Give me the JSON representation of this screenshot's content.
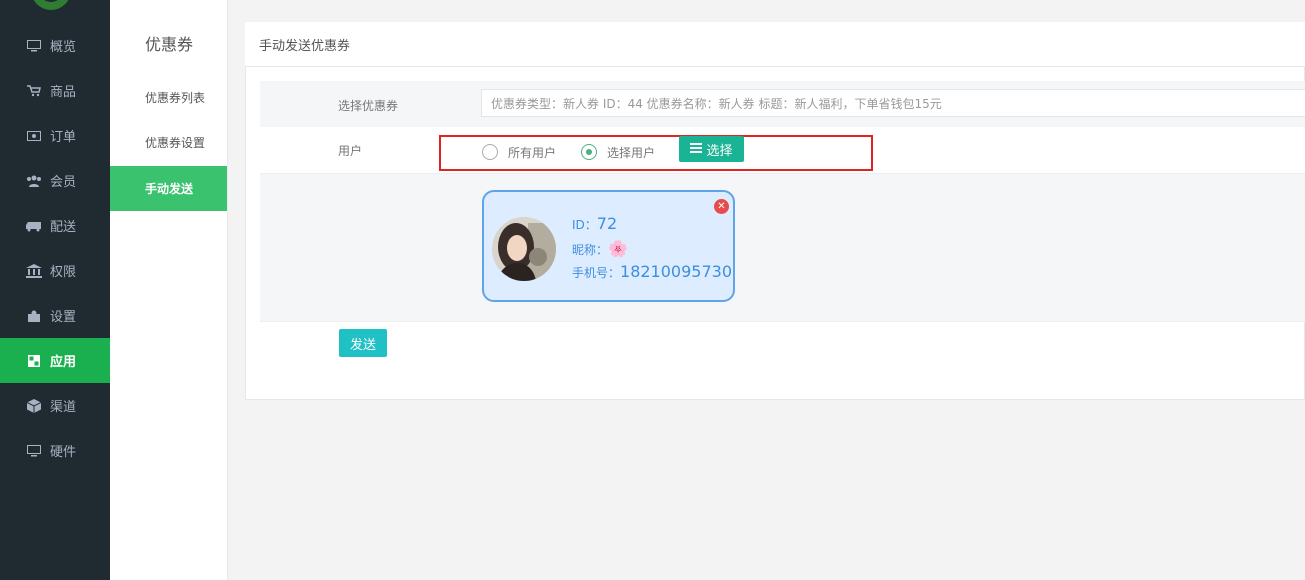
{
  "nav": {
    "items": [
      {
        "label": "概览",
        "icon": "monitor-icon"
      },
      {
        "label": "商品",
        "icon": "cart-icon"
      },
      {
        "label": "订单",
        "icon": "order-icon"
      },
      {
        "label": "会员",
        "icon": "users-icon"
      },
      {
        "label": "配送",
        "icon": "truck-icon"
      },
      {
        "label": "权限",
        "icon": "bank-icon"
      },
      {
        "label": "设置",
        "icon": "puzzle-icon"
      },
      {
        "label": "应用",
        "icon": "app-icon"
      },
      {
        "label": "渠道",
        "icon": "cube-icon"
      },
      {
        "label": "硬件",
        "icon": "desktop-icon"
      }
    ],
    "active": "应用"
  },
  "subnav": {
    "title": "优惠券",
    "items": [
      "优惠券列表",
      "优惠券设置",
      "手动发送"
    ],
    "active": "手动发送"
  },
  "main": {
    "title": "手动发送优惠券",
    "coupon_label": "选择优惠券",
    "coupon_placeholder": "优惠券类型：新人券 ID：44 优惠券名称：新人券 标题：新人福利，下单省钱包15元",
    "user_label": "用户",
    "radio_all": "所有用户",
    "radio_select": "选择用户",
    "select_button": "选择",
    "selected_radio": "选择用户",
    "user_card": {
      "id_label": "ID：",
      "id_value": "72",
      "nickname_label": "昵称：",
      "nickname_value": "🌸",
      "phone_label": "手机号：",
      "phone_value": "18210095730"
    },
    "send_button": "发送"
  },
  "colors": {
    "nav_bg": "#1f2b30",
    "active_green": "#1ab04f",
    "highlight_red": "#e02424",
    "select_btn": "#1ab394",
    "send_btn": "#1fc1c4",
    "card_border": "#5fa3e8"
  }
}
